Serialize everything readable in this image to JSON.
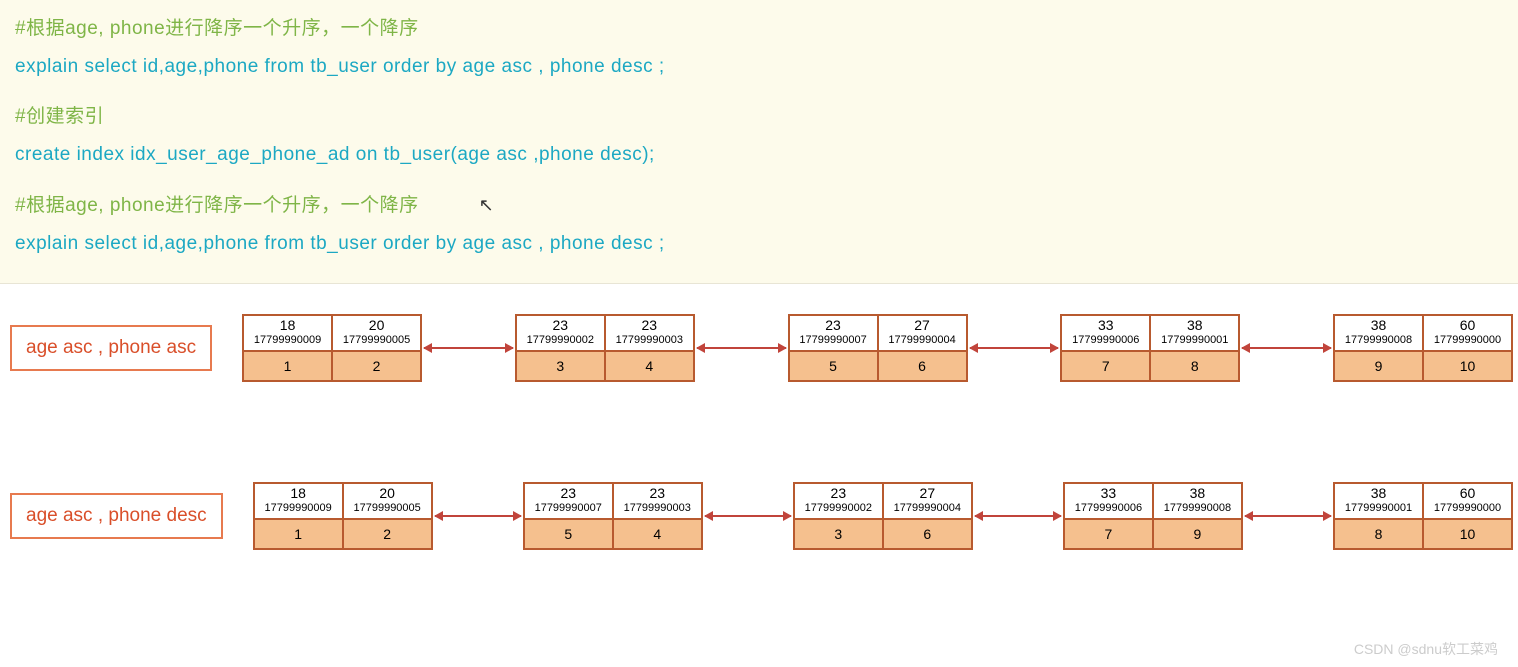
{
  "code": {
    "c1": "#根据age, phone进行降序一个升序，一个降序",
    "s1": "explain select  id,age,phone from tb_user order by age asc , phone  desc ;",
    "c2": "#创建索引",
    "s2": "create  index  idx_user_age_phone_ad  on  tb_user(age asc ,phone desc);",
    "c3": "#根据age, phone进行降序一个升序，一个降序",
    "s3": "explain select  id,age,phone from tb_user order by age asc , phone  desc ;"
  },
  "row1": {
    "label": "age asc , phone  asc",
    "groups": [
      {
        "cells": [
          {
            "age": "18",
            "phone": "17799990009",
            "id": "1"
          },
          {
            "age": "20",
            "phone": "17799990005",
            "id": "2"
          }
        ]
      },
      {
        "cells": [
          {
            "age": "23",
            "phone": "17799990002",
            "id": "3"
          },
          {
            "age": "23",
            "phone": "17799990003",
            "id": "4"
          }
        ]
      },
      {
        "cells": [
          {
            "age": "23",
            "phone": "17799990007",
            "id": "5"
          },
          {
            "age": "27",
            "phone": "17799990004",
            "id": "6"
          }
        ]
      },
      {
        "cells": [
          {
            "age": "33",
            "phone": "17799990006",
            "id": "7"
          },
          {
            "age": "38",
            "phone": "17799990001",
            "id": "8"
          }
        ]
      },
      {
        "cells": [
          {
            "age": "38",
            "phone": "17799990008",
            "id": "9"
          },
          {
            "age": "60",
            "phone": "17799990000",
            "id": "10"
          }
        ]
      }
    ]
  },
  "row2": {
    "label": "age asc , phone  desc",
    "groups": [
      {
        "cells": [
          {
            "age": "18",
            "phone": "17799990009",
            "id": "1"
          },
          {
            "age": "20",
            "phone": "17799990005",
            "id": "2"
          }
        ]
      },
      {
        "cells": [
          {
            "age": "23",
            "phone": "17799990007",
            "id": "5"
          },
          {
            "age": "23",
            "phone": "17799990003",
            "id": "4"
          }
        ]
      },
      {
        "cells": [
          {
            "age": "23",
            "phone": "17799990002",
            "id": "3"
          },
          {
            "age": "27",
            "phone": "17799990004",
            "id": "6"
          }
        ]
      },
      {
        "cells": [
          {
            "age": "33",
            "phone": "17799990006",
            "id": "7"
          },
          {
            "age": "38",
            "phone": "17799990008",
            "id": "9"
          }
        ]
      },
      {
        "cells": [
          {
            "age": "38",
            "phone": "17799990001",
            "id": "8"
          },
          {
            "age": "60",
            "phone": "17799990000",
            "id": "10"
          }
        ]
      }
    ]
  },
  "watermark": "CSDN @sdnu软工菜鸡"
}
